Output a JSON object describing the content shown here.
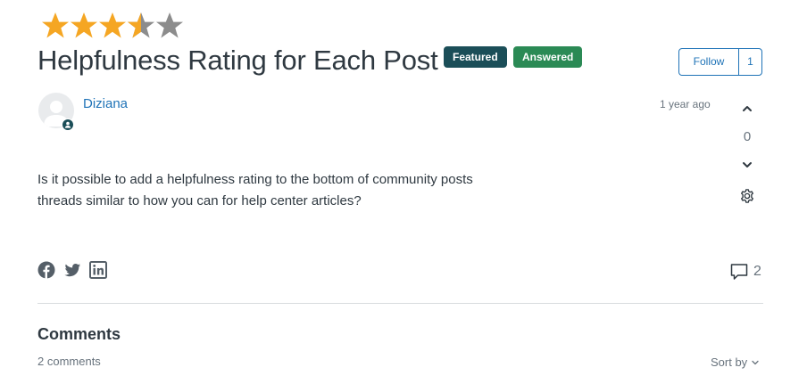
{
  "rating": {
    "value": 3.5,
    "max": 5,
    "filled_color": "#f5a623",
    "empty_color": "#8c8c8c"
  },
  "post": {
    "title": "Helpfulness Rating for Each Post",
    "badges": {
      "featured": "Featured",
      "answered": "Answered"
    },
    "follow": {
      "label": "Follow",
      "count": "1"
    },
    "author": {
      "name": "Diziana"
    },
    "timestamp": "1 year ago",
    "votes": "0",
    "body_lines": [
      "Is it possible to add a helpfulness rating to the bottom of community posts",
      "threads similar to how you can for help center articles?"
    ],
    "comment_count": "2"
  },
  "share": {
    "icons": [
      "facebook-icon",
      "twitter-icon",
      "linkedin-icon"
    ]
  },
  "comments": {
    "heading": "Comments",
    "count_label": "2 comments",
    "sort_label": "Sort by"
  },
  "colors": {
    "accent": "#1f73b7",
    "featured_badge": "#1b4e58",
    "answered_badge": "#2b8a55",
    "text": "#2f3941",
    "muted": "#68737d"
  }
}
